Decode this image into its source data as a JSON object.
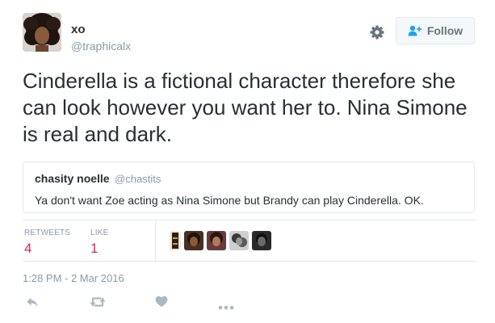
{
  "tweet": {
    "author": {
      "display_name": "xo",
      "screen_name": "@traphicalx"
    },
    "text": "Cinderella is a fictional character therefore she can look however you want her to. Nina Simone is real and dark.",
    "follow_label": "Follow",
    "quoted": {
      "name": "chasity noelle",
      "handle": "@chastits",
      "text": "Ya don't want Zoe acting as Nina Simone but Brandy can play Cinderella. OK."
    },
    "stats": {
      "retweets_label": "RETWEETS",
      "retweets_count": "4",
      "likes_label": "LIKE",
      "likes_count": "1"
    },
    "timestamp": "1:28 PM - 2 Mar 2016"
  },
  "colors": {
    "accent": "#e0245e",
    "muted": "#8899a6",
    "text": "#292f33",
    "border": "#e1e8ed"
  },
  "icons": {
    "settings": "gear-icon",
    "follow": "add-user-icon",
    "reply": "reply-icon",
    "retweet": "retweet-icon",
    "like": "heart-icon",
    "more": "more-dots-icon"
  }
}
